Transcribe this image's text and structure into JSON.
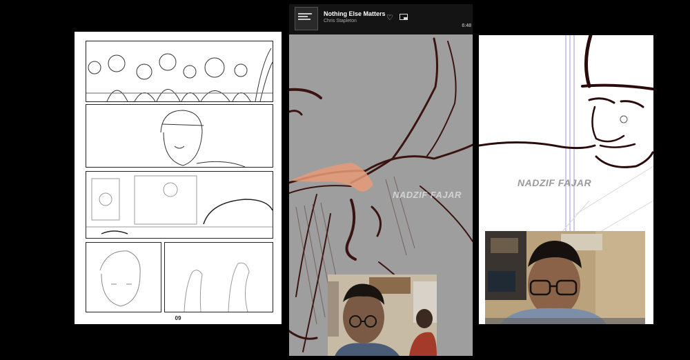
{
  "music_player": {
    "track_title": "Nothing Else Matters",
    "artist": "Chris Stapleton",
    "time": "6:48",
    "icons": {
      "like": "heart-icon",
      "miniplayer": "miniplayer-icon"
    }
  },
  "comic_page": {
    "page_number": "09"
  },
  "watermarks": {
    "center": "NADZIF FAJAR",
    "right": "NADZIF FAJAR"
  },
  "colors": {
    "background": "#000000",
    "canvas_gray": "#9e9e9e",
    "sketch_ink": "#3a1410",
    "accent_skin": "#e79a77",
    "guide_line": "#8a7bd8"
  }
}
